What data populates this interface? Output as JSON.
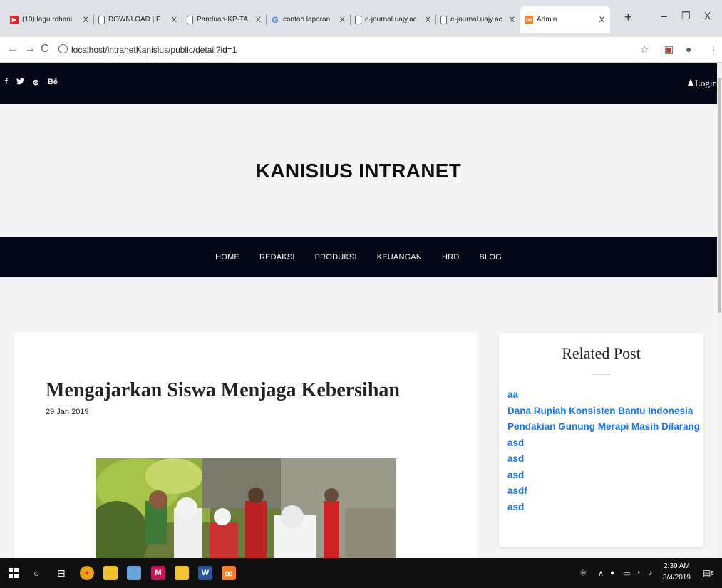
{
  "browser": {
    "tabs": [
      {
        "title": "(10) lagu rohani",
        "icon": "youtube-icon"
      },
      {
        "title": "DOWNLOAD | F",
        "icon": "document-icon"
      },
      {
        "title": "Panduan-KP-TA",
        "icon": "document-icon"
      },
      {
        "title": "contoh laporan",
        "icon": "google-icon"
      },
      {
        "title": "e-journal.uajy.ac",
        "icon": "document-icon"
      },
      {
        "title": "e-journal.uajy.ac",
        "icon": "document-icon"
      },
      {
        "title": "Admin",
        "icon": "xampp-icon",
        "active": true
      }
    ],
    "url": "localhost/intranetKanisius/public/detail?id=1"
  },
  "site": {
    "social": [
      "f",
      "y",
      "⊛",
      "Bē"
    ],
    "login_label": "Login",
    "brand": "KANISIUS INTRANET",
    "nav": [
      "HOME",
      "REDAKSI",
      "PRODUKSI",
      "KEUANGAN",
      "HRD",
      "BLOG"
    ]
  },
  "post": {
    "title": "Mengajarkan Siswa Menjaga Kebersihan",
    "date": "29 Jan 2019"
  },
  "sidebar": {
    "title": "Related Post",
    "items": [
      "aa",
      "Dana Rupiah Konsisten Bantu Indonesia",
      "Pendakian Gunung Merapi Masih Dilarang",
      "asd",
      "asd",
      "asd",
      "asdf",
      "asd"
    ]
  },
  "taskbar": {
    "time": "2:39 AM",
    "date": "3/4/2019",
    "notification_count": "5"
  },
  "colors": {
    "dark_nav": "#030716",
    "link_blue": "#1a73e8",
    "page_bg": "#f5f5f5"
  }
}
